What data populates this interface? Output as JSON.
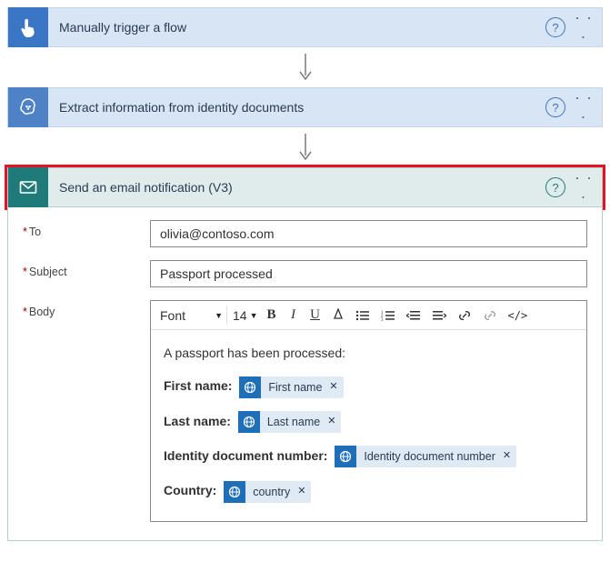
{
  "steps": [
    {
      "title": "Manually trigger a flow"
    },
    {
      "title": "Extract information from identity documents"
    },
    {
      "title": "Send an email notification (V3)"
    }
  ],
  "form": {
    "to_label": "To",
    "to_value": "olivia@contoso.com",
    "subject_label": "Subject",
    "subject_value": "Passport processed",
    "body_label": "Body"
  },
  "toolbar": {
    "font_label": "Font",
    "size_label": "14"
  },
  "body": {
    "intro": "A passport has been processed:",
    "lines": [
      {
        "label": "First name:",
        "token": "First name"
      },
      {
        "label": "Last name:",
        "token": "Last name"
      },
      {
        "label": "Identity document number:",
        "token": "Identity document number"
      },
      {
        "label": "Country:",
        "token": "country"
      }
    ]
  }
}
